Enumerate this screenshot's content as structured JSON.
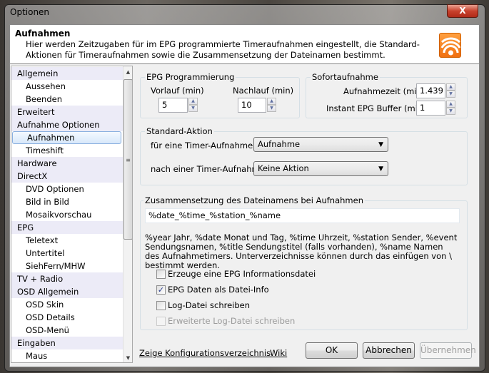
{
  "window": {
    "title": "Optionen",
    "close_label": "X"
  },
  "header": {
    "title": "Aufnahmen",
    "description": "Hier werden Zeitzugaben für im EPG programmierte Timeraufnahmen eingestellt, die Standard-Aktionen für Timeraufnahmen sowie die Zusammensetzung der Dateinamen bestimmt."
  },
  "sidebar": {
    "items": [
      {
        "label": "Allgemein",
        "type": "grp"
      },
      {
        "label": "Aussehen",
        "type": "sub"
      },
      {
        "label": "Beenden",
        "type": "sub"
      },
      {
        "label": "Erweitert",
        "type": "grp"
      },
      {
        "label": "Aufnahme Optionen",
        "type": "grp"
      },
      {
        "label": "Aufnahmen",
        "type": "sub sel"
      },
      {
        "label": "Timeshift",
        "type": "sub"
      },
      {
        "label": "Hardware",
        "type": "grp"
      },
      {
        "label": "DirectX",
        "type": "grp"
      },
      {
        "label": "DVD Optionen",
        "type": "sub"
      },
      {
        "label": "Bild in Bild",
        "type": "sub"
      },
      {
        "label": "Mosaikvorschau",
        "type": "sub"
      },
      {
        "label": "EPG",
        "type": "grp"
      },
      {
        "label": "Teletext",
        "type": "sub"
      },
      {
        "label": "Untertitel",
        "type": "sub"
      },
      {
        "label": "SiehFern/MHW",
        "type": "sub"
      },
      {
        "label": "TV + Radio",
        "type": "grp"
      },
      {
        "label": "OSD Allgemein",
        "type": "grp"
      },
      {
        "label": "OSD Skin",
        "type": "sub"
      },
      {
        "label": "OSD Details",
        "type": "sub"
      },
      {
        "label": "OSD-Menü",
        "type": "sub"
      },
      {
        "label": "Eingaben",
        "type": "grp"
      },
      {
        "label": "Maus",
        "type": "sub"
      }
    ]
  },
  "epg": {
    "title": "EPG Programmierung",
    "vorlauf_label": "Vorlauf (min)",
    "vorlauf_value": "5",
    "nachlauf_label": "Nachlauf (min)",
    "nachlauf_value": "10"
  },
  "sofort": {
    "title": "Sofortaufnahme",
    "aufnahmezeit_label": "Aufnahmezeit (min)",
    "aufnahmezeit_value": "1.439",
    "buffer_label": "Instant EPG Buffer (min)",
    "buffer_value": "1"
  },
  "standard": {
    "title": "Standard-Aktion",
    "fuer_label": "für eine Timer-Aufnahme",
    "fuer_value": "Aufnahme",
    "nach_label": "nach einer Timer-Aufnahme",
    "nach_value": "Keine Aktion"
  },
  "filename": {
    "title": "Zusammensetzung des Dateinamens bei Aufnahmen",
    "value": "%date_%time_%station_%name",
    "help": "%year Jahr, %date Monat und Tag, %time Uhrzeit, %station Sender, %event Sendungsnamen, %title Sendungstitel (falls vorhanden), %name Namen des Aufnahmetimers. Unterverzeichnisse können durch das einfügen von \\ bestimmt werden.",
    "checkboxes": [
      {
        "label": "Erzeuge eine EPG Informationsdatei",
        "checked": false,
        "disabled": false
      },
      {
        "label": "EPG Daten als Datei-Info",
        "checked": true,
        "disabled": false
      },
      {
        "label": "Log-Datei schreiben",
        "checked": false,
        "disabled": false
      },
      {
        "label": "Erweiterte Log-Datei schreiben",
        "checked": false,
        "disabled": true
      }
    ]
  },
  "footer": {
    "config_link": "Zeige Konfigurationsverzeichnis",
    "wiki_link": "Wiki",
    "ok": "OK",
    "cancel": "Abbrechen",
    "apply": "Übernehmen"
  }
}
